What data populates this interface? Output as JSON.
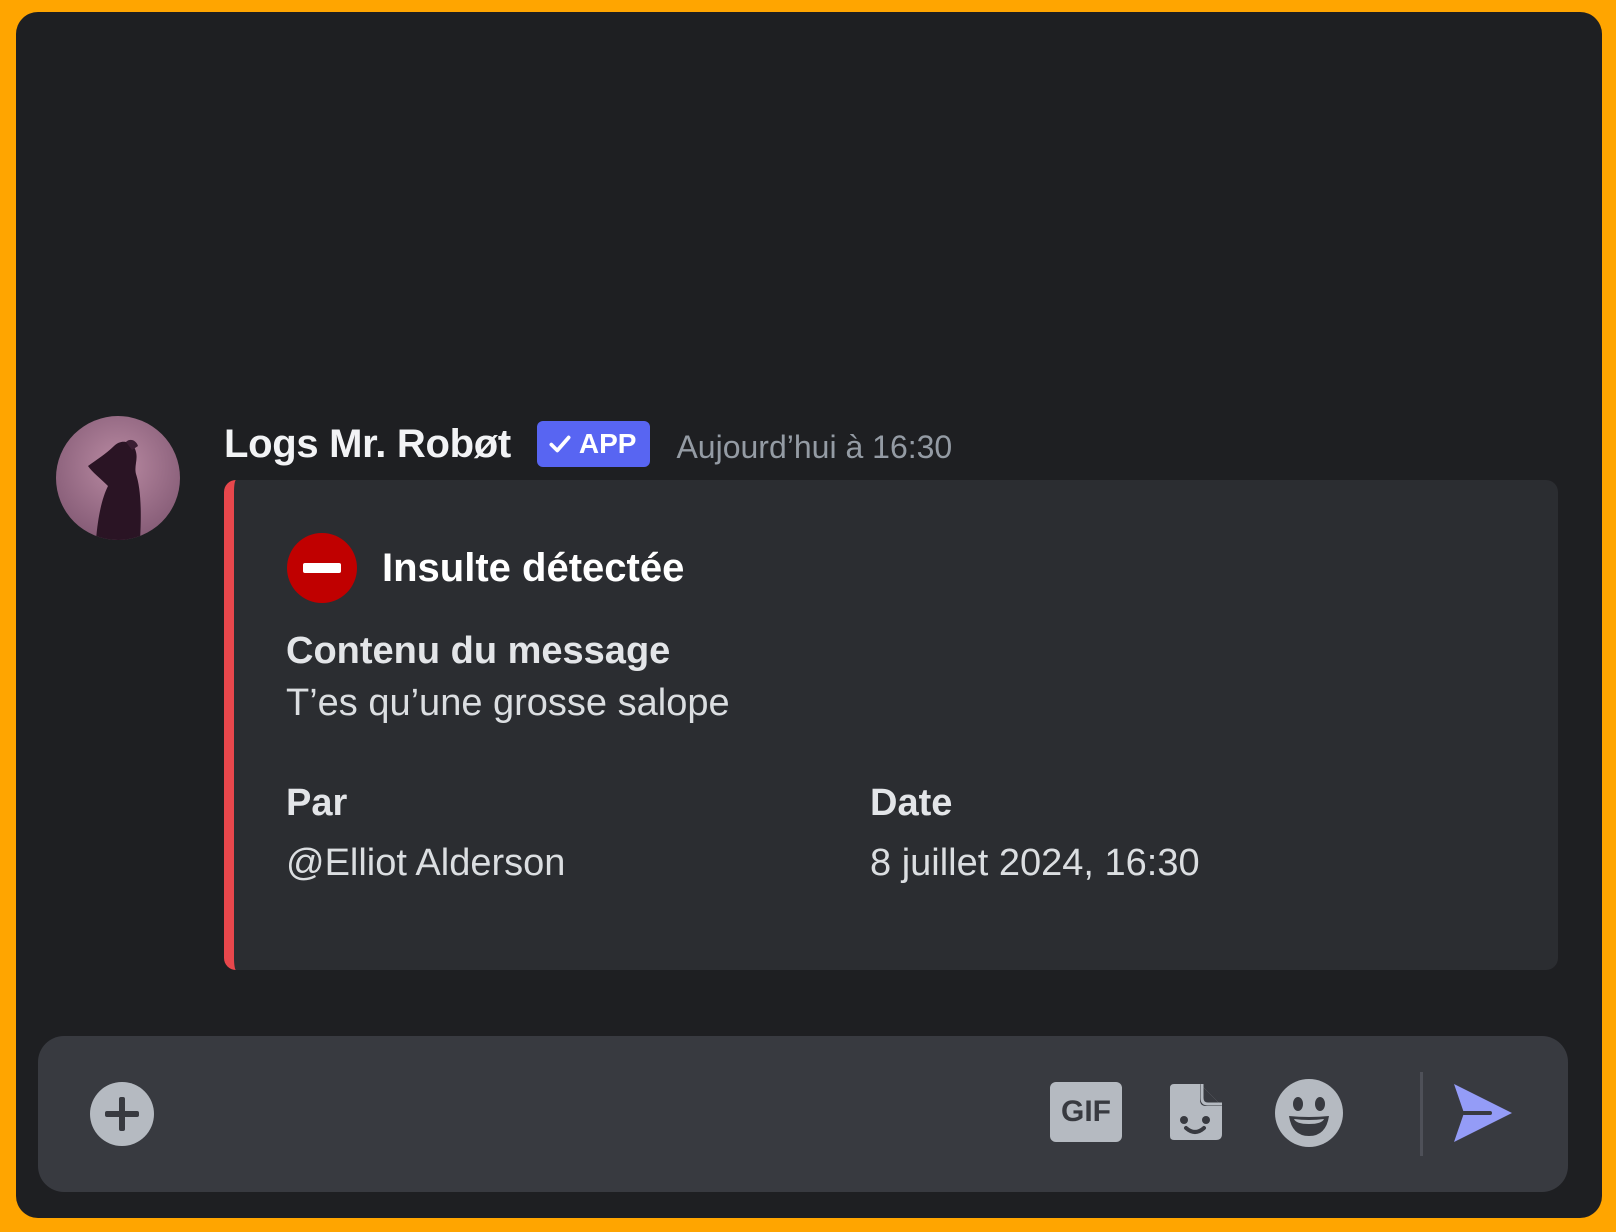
{
  "message": {
    "author": "Logs Mr. Robøt",
    "badge_label": "APP",
    "timestamp": "Aujourd’hui à 16:30"
  },
  "embed": {
    "accent_color": "#e8474c",
    "icon": "stop-sign-icon",
    "title": "Insulte détectée",
    "content_field": {
      "name": "Contenu du message",
      "value": "T’es qu’une grosse salope"
    },
    "author_field": {
      "name": "Par",
      "value": "@Elliot Alderson"
    },
    "date_field": {
      "name": "Date",
      "value": "8 juillet 2024, 16:30"
    }
  },
  "composer": {
    "placeholder": "",
    "gif_label": "GIF",
    "icons": [
      "plus-circle-icon",
      "gif-icon",
      "sticker-icon",
      "emoji-icon",
      "send-icon"
    ],
    "send_color": "#949cf7"
  },
  "colors": {
    "frame_border": "#ffa500",
    "background": "#1e1f22",
    "badge": "#5865f2",
    "stop_icon": "#c00000"
  }
}
